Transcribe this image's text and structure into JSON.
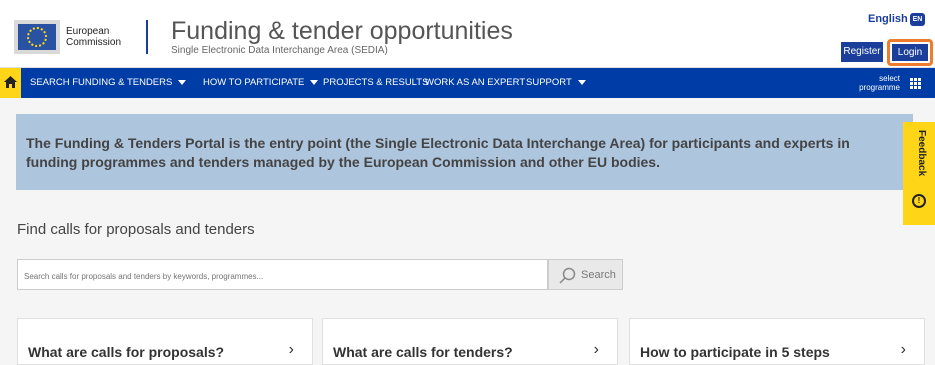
{
  "header": {
    "logo_text": "European Commission",
    "site_title": "Funding & tender opportunities",
    "site_subtitle": "Single Electronic Data Interchange Area (SEDIA)",
    "language": "English",
    "language_code": "EN",
    "register_label": "Register",
    "login_label": "Login"
  },
  "nav": {
    "items": [
      {
        "label": "SEARCH FUNDING & TENDERS",
        "dropdown": true
      },
      {
        "label": "HOW TO PARTICIPATE",
        "dropdown": true
      },
      {
        "label": "PROJECTS & RESULTS",
        "dropdown": false
      },
      {
        "label": "WORK AS AN EXPERT",
        "dropdown": false
      },
      {
        "label": "SUPPORT",
        "dropdown": true
      }
    ],
    "select_programme": "select programme"
  },
  "banner": {
    "text": "The Funding & Tenders Portal is the entry point (the Single Electronic Data Interchange Area) for participants and experts in funding programmes and tenders managed by the European Commission and other EU bodies."
  },
  "feedback": {
    "label": "Feedback"
  },
  "search": {
    "title": "Find calls for proposals and tenders",
    "placeholder": "Search calls for proposals and tenders by keywords, programmes...",
    "button_label": "Search"
  },
  "cards": [
    {
      "title": "What are calls for proposals?"
    },
    {
      "title": "What are calls for tenders?"
    },
    {
      "title": "How to participate in 5 steps"
    }
  ],
  "colors": {
    "primary": "#003ca5",
    "accent": "#ffd617",
    "highlight": "#ef7c2c",
    "banner": "#aec5de"
  },
  "icons": [
    "home-icon",
    "grid-icon",
    "search-icon",
    "chevron-right-icon",
    "feedback-icon",
    "eu-flag-icon"
  ]
}
